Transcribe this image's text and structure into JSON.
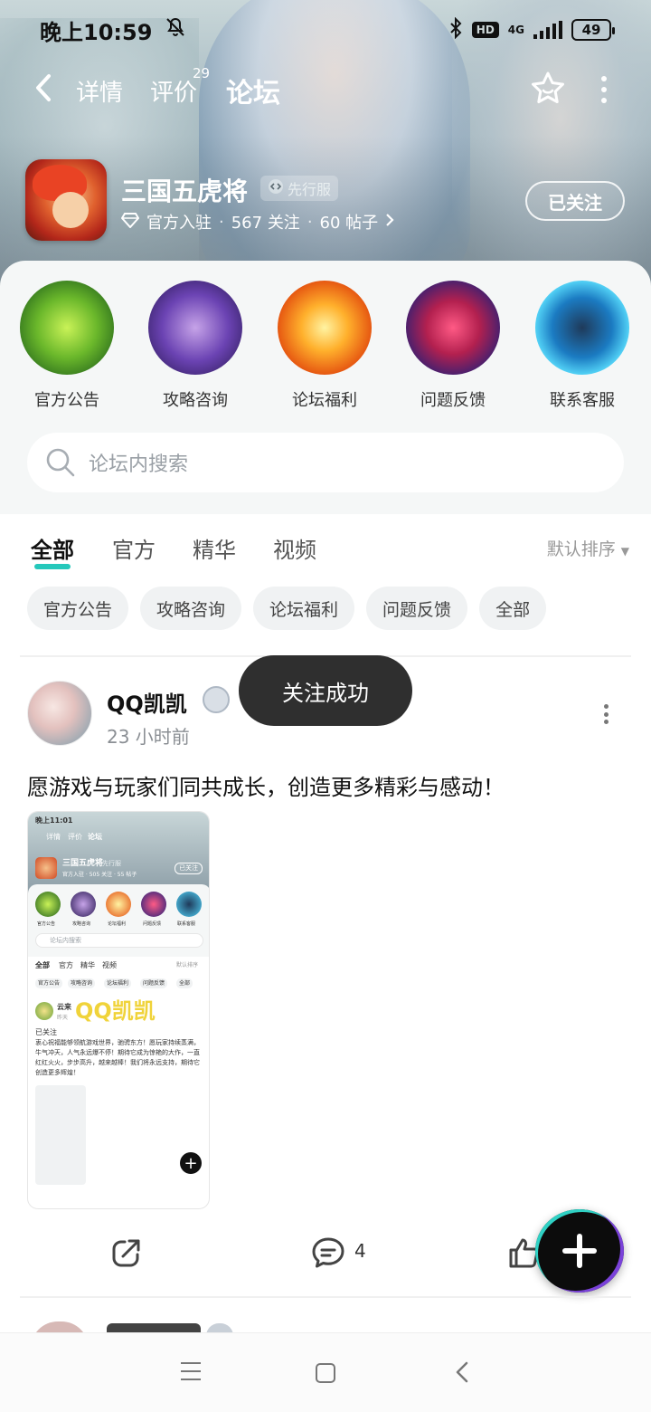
{
  "status_bar": {
    "time": "晚上10:59",
    "network": "4G",
    "hd": "HD",
    "battery": "49"
  },
  "nav": {
    "tabs": [
      {
        "label": "详情"
      },
      {
        "label": "评价",
        "count": "29"
      },
      {
        "label": "论坛"
      }
    ],
    "active_tab": "论坛"
  },
  "game": {
    "name": "三国五虎将",
    "badge": "先行服",
    "official": "官方入驻",
    "followers": "567 关注",
    "posts": "60 帖子",
    "follow_button": "已关注"
  },
  "categories": [
    {
      "label": "官方公告",
      "color": "green"
    },
    {
      "label": "攻略咨询",
      "color": "purple"
    },
    {
      "label": "论坛福利",
      "color": "orange"
    },
    {
      "label": "问题反馈",
      "color": "red"
    },
    {
      "label": "联系客服",
      "color": "blue"
    }
  ],
  "search": {
    "placeholder": "论坛内搜索"
  },
  "feed_tabs": {
    "items": [
      "全部",
      "官方",
      "精华",
      "视频"
    ],
    "active": "全部",
    "sort": "默认排序"
  },
  "chips": [
    "官方公告",
    "攻略咨询",
    "论坛福利",
    "问题反馈",
    "全部"
  ],
  "toast": "关注成功",
  "post": {
    "author": "QQ凯凯",
    "time": "23 小时前",
    "text": "愿游戏与玩家们同共成长，创造更多精彩与感动！",
    "comments": "4",
    "thumbnail": {
      "status_time": "晚上11:01",
      "tabs": [
        "详情",
        "评价",
        "论坛"
      ],
      "game_name": "三国五虎将",
      "badge": "先行服",
      "meta": "官方入驻 · 505 关注 · 55 帖子",
      "follow": "已关注",
      "categories": [
        "官方公告",
        "攻略咨询",
        "论坛福利",
        "问题反馈",
        "联系客服"
      ],
      "search": "论坛内搜索",
      "feed_tabs": [
        "全部",
        "官方",
        "精华",
        "视频"
      ],
      "sort": "默认排序",
      "chips": [
        "官方公告",
        "攻略咨询",
        "论坛福利",
        "问题反馈",
        "全部"
      ],
      "author": "云来",
      "time": "昨天",
      "watermark": "QQ凯凯",
      "followed": "已关注",
      "text": "衷心祝福能够领航游戏世界，驰骋东方！愿玩家持续蒸满，牛气冲天，人气永远爆不停！期待它成为惊艳的大作，一直红红火火，步步高升，越来越棒！我们将永远支持，期待它创造更多辉煌！"
    }
  },
  "colors": {
    "accent": "#25c8bb",
    "toast_bg": "#2f2f2f"
  }
}
